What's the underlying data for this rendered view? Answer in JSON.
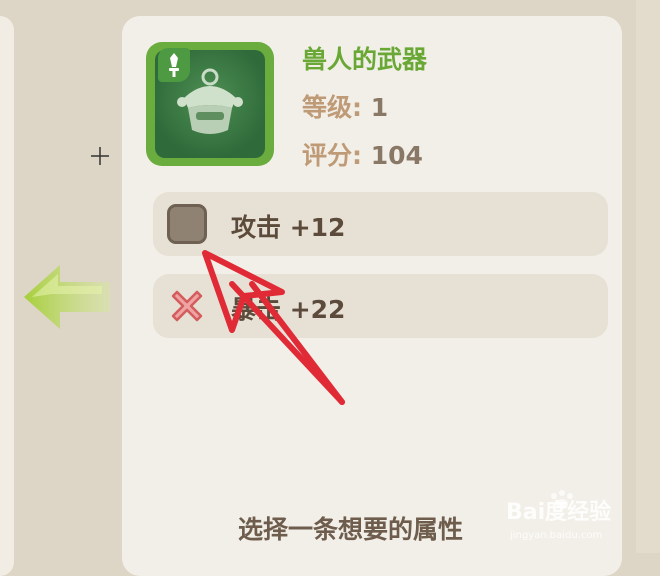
{
  "item": {
    "name": "兽人的武器",
    "level_label": "等级:",
    "level_value": "1",
    "score_label": "评分:",
    "score_value": "104",
    "icon": "orc-helmet-icon",
    "badge_icon": "sword-icon"
  },
  "options": [
    {
      "label": "攻击 +12",
      "icon": "checkbox-icon"
    },
    {
      "label": "暴击 +22",
      "icon": "cross-icon"
    }
  ],
  "hint": "选择一条想要的属性",
  "back_icon": "green-left-arrow-icon",
  "annotation": "red-pointer-arrow",
  "watermark": {
    "brand": "Bai度经验",
    "url": "jingyan.baidu.com"
  },
  "colors": {
    "name_green": "#6aa836",
    "label_tan": "#bf9a76",
    "annotation_red": "#e02a36"
  }
}
